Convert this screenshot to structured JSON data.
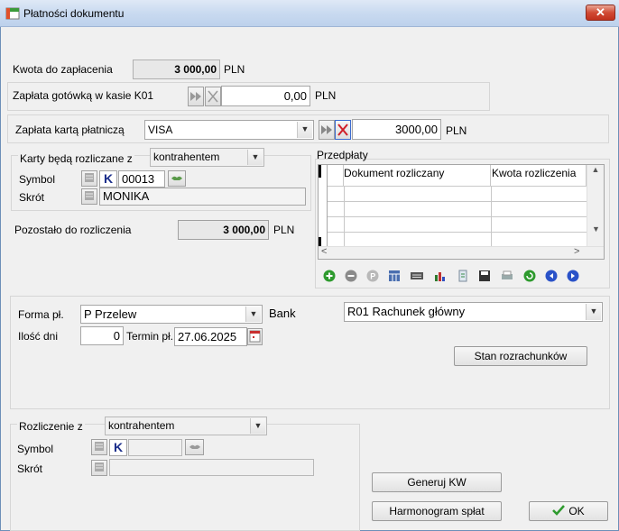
{
  "window": {
    "title": "Płatności dokumentu",
    "close_glyph": "✕"
  },
  "amount_due": {
    "label": "Kwota do zapłacenia",
    "value": "3 000,00",
    "currency": "PLN"
  },
  "cash": {
    "label": "Zapłata gotówką w kasie K01",
    "value": "0,00",
    "currency": "PLN"
  },
  "card": {
    "label": "Zapłata kartą płatniczą",
    "selected": "VISA",
    "value": "3000,00",
    "currency": "PLN"
  },
  "card_settlement": {
    "label": "Karty będą rozliczane z",
    "selected": "kontrahentem",
    "symbol_label": "Symbol",
    "type_letter": "K",
    "symbol_value": "00013",
    "short_label": "Skrót",
    "short_value": "MONIKA"
  },
  "remaining": {
    "label": "Pozostało do rozliczenia",
    "value": "3 000,00",
    "currency": "PLN"
  },
  "prepayments": {
    "title": "Przedpłaty",
    "columns": [
      "Dokument rozliczany",
      "Kwota rozliczenia"
    ],
    "toolbar_icons": [
      "add-icon",
      "remove-icon",
      "p-icon",
      "table-icon",
      "keyboard-icon",
      "chart-icon",
      "document-icon",
      "save-icon",
      "print-icon",
      "refresh-icon",
      "first-icon",
      "last-icon"
    ]
  },
  "payment": {
    "form_label": "Forma pł.",
    "form_value": "P  Przelew",
    "bank_label": "Bank",
    "bank_value": "R01 Rachunek główny",
    "days_label": "Ilość dni",
    "days_value": "0",
    "due_label": "Termin pł.",
    "due_value": "27.06.2025",
    "status_button": "Stan rozrachunków"
  },
  "settlement": {
    "label": "Rozliczenie z",
    "selected": "kontrahentem",
    "symbol_label": "Symbol",
    "type_letter": "K",
    "short_label": "Skrót"
  },
  "buttons": {
    "generate": "Generuj KW",
    "schedule": "Harmonogram spłat",
    "ok": "OK"
  },
  "colors": {
    "accent": "#1a2d8a",
    "close": "#c1301c"
  }
}
